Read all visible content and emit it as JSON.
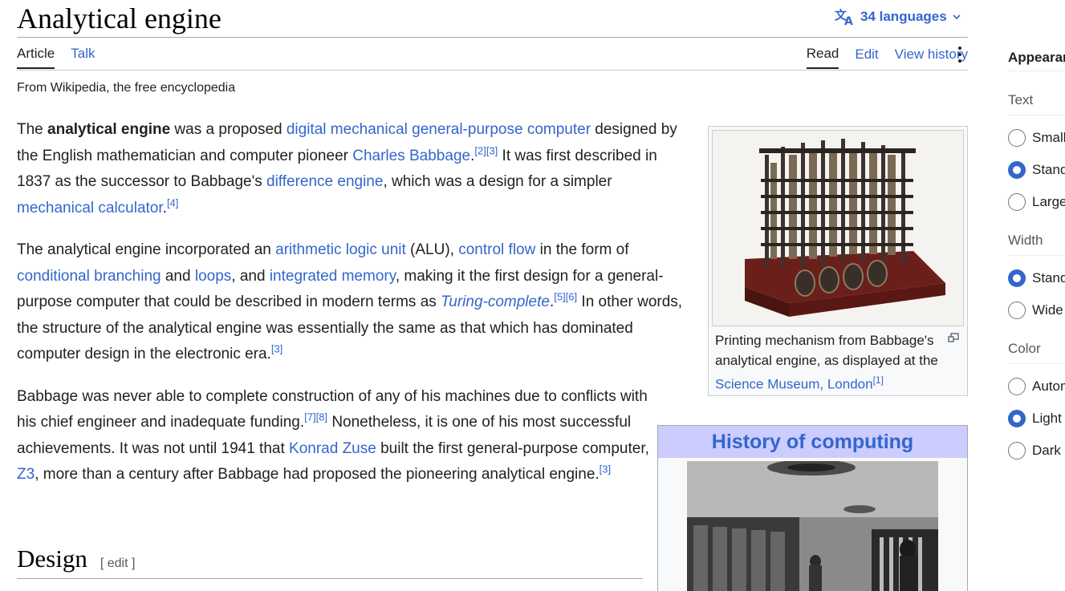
{
  "page": {
    "title": "Analytical engine",
    "languages": "34 languages",
    "tagline": "From Wikipedia, the free encyclopedia"
  },
  "tabs": {
    "article": "Article",
    "talk": "Talk",
    "read": "Read",
    "edit": "Edit",
    "history": "View history"
  },
  "p1": {
    "t1": "The ",
    "b1": "analytical engine",
    "t2": " was a proposed ",
    "l1": "digital mechanical general-purpose computer",
    "t3": " designed by the English mathematician and computer pioneer ",
    "l2": "Charles Babbage",
    "t4": ".",
    "s1": "[2][3]",
    "t5": " It was first described in 1837 as the successor to Babbage's ",
    "l3": "difference engine",
    "t6": ", which was a design for a simpler ",
    "l4": "mechanical calculator",
    "t7": ".",
    "s2": "[4]"
  },
  "p2": {
    "t1": "The analytical engine incorporated an ",
    "l1": "arithmetic logic unit",
    "t2": " (ALU), ",
    "l2": "control flow",
    "t3": " in the form of ",
    "l3": "conditional branching",
    "t4": " and ",
    "l4": "loops",
    "t5": ", and ",
    "l5": "integrated memory",
    "t6": ", making it the first design for a general-purpose computer that could be described in modern terms as ",
    "l6": "Turing-complete",
    "t7": ".",
    "s1": "[5][6]",
    "t8": " In other words, the structure of the analytical engine was essentially the same as that which has dominated computer design in the electronic era.",
    "s2": "[3]"
  },
  "p3": {
    "t1": "Babbage was never able to complete construction of any of his machines due to conflicts with his chief engineer and inadequate funding.",
    "s1": "[7][8]",
    "t2": " Nonetheless, it is one of his most successful achievements. It was not until 1941 that ",
    "l1": "Konrad Zuse",
    "t3": " built the first general-purpose computer, ",
    "l2": "Z3",
    "t4": ", more than a century after Babbage had proposed the pioneering analytical engine.",
    "s2": "[3]"
  },
  "infobox1": {
    "caption": "Printing mechanism from Babbage's analytical engine, as displayed at the ",
    "link": "Science Museum, London",
    "sup": "[1]"
  },
  "infobox2": {
    "title": "History of computing"
  },
  "section": {
    "title": "Design",
    "edit": "[ edit ]"
  },
  "appearance": {
    "title": "Appearance",
    "text_label": "Text",
    "text_options": [
      "Small",
      "Standard",
      "Large"
    ],
    "width_label": "Width",
    "width_options": [
      "Standard",
      "Wide"
    ],
    "color_label": "Color",
    "color_options": [
      "Automatic",
      "Light",
      "Dark"
    ]
  },
  "colors": {
    "link": "#3366cc",
    "infobox_header": "#ccccff",
    "text": "#202122"
  }
}
